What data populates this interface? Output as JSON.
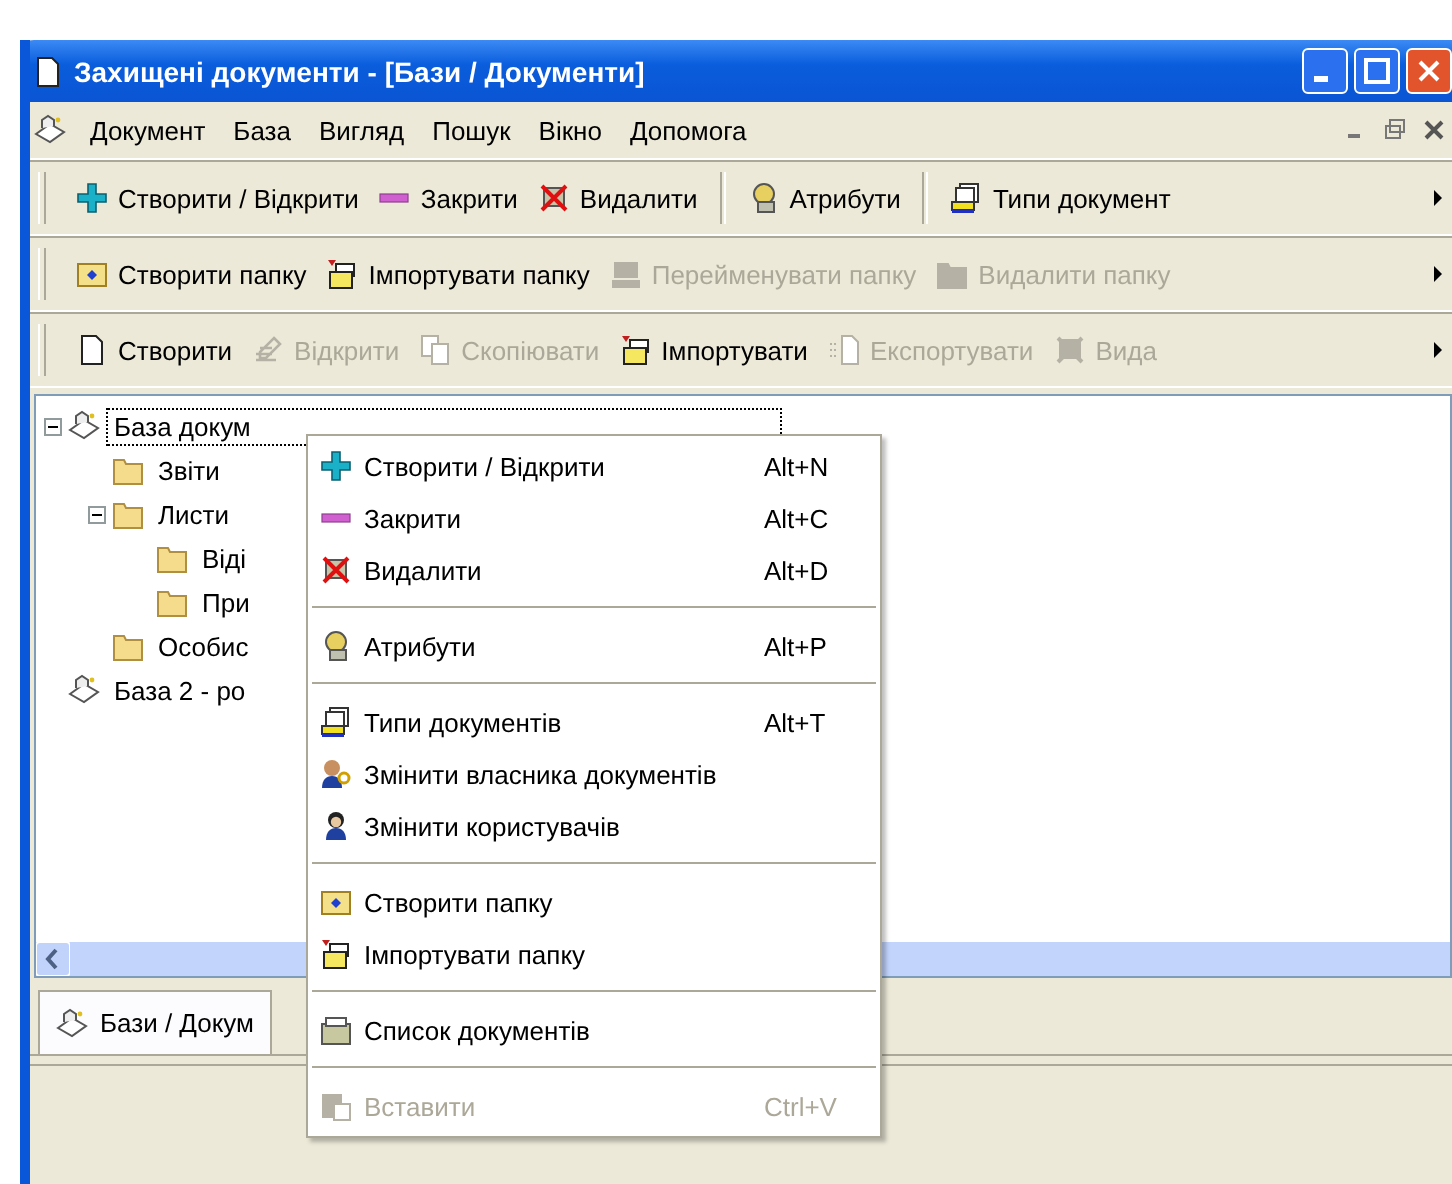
{
  "window": {
    "title": "Захищені документи - [Бази / Документи]"
  },
  "menu_bar": [
    "Документ",
    "База",
    "Вигляд",
    "Пошук",
    "Вікно",
    "Допомога"
  ],
  "toolbars": [
    [
      {
        "kind": "button",
        "label": "Створити / Відкрити",
        "disabled": false
      },
      {
        "kind": "button",
        "label": "Закрити",
        "disabled": false
      },
      {
        "kind": "button",
        "label": "Видалити",
        "disabled": false
      },
      {
        "kind": "separator"
      },
      {
        "kind": "button",
        "label": "Атрибути",
        "disabled": false
      },
      {
        "kind": "separator"
      },
      {
        "kind": "button",
        "label": "Типи документ",
        "disabled": false
      }
    ],
    [
      {
        "kind": "button",
        "label": "Створити папку",
        "disabled": false
      },
      {
        "kind": "button",
        "label": "Імпортувати папку",
        "disabled": false
      },
      {
        "kind": "button",
        "label": "Перейменувати папку",
        "disabled": true
      },
      {
        "kind": "button",
        "label": "Видалити папку",
        "disabled": true
      }
    ],
    [
      {
        "kind": "button",
        "label": "Створити",
        "disabled": false
      },
      {
        "kind": "button",
        "label": "Відкрити",
        "disabled": true
      },
      {
        "kind": "button",
        "label": "Скопіювати",
        "disabled": true
      },
      {
        "kind": "button",
        "label": "Імпортувати",
        "disabled": false
      },
      {
        "kind": "button",
        "label": "Експортувати",
        "disabled": true
      },
      {
        "kind": "button",
        "label": "Вида",
        "disabled": true
      }
    ]
  ],
  "tree": [
    {
      "label": "База докум",
      "kind": "database",
      "selected": true,
      "expanded": true,
      "children": [
        {
          "label": "Звіти",
          "kind": "folder",
          "selected": false
        },
        {
          "label": "Листи",
          "kind": "folder",
          "selected": false,
          "expanded": true,
          "children": [
            {
              "label": "Віді",
              "kind": "folder",
              "selected": false
            },
            {
              "label": "При",
              "kind": "folder",
              "selected": false
            }
          ]
        },
        {
          "label": "Особис",
          "kind": "folder",
          "selected": false
        }
      ]
    },
    {
      "label": "База 2 - ро",
      "kind": "database",
      "selected": false
    }
  ],
  "context_menu": [
    [
      {
        "label": "Створити / Відкрити",
        "shortcut": "Alt+N",
        "disabled": false
      },
      {
        "label": "Закрити",
        "shortcut": "Alt+C",
        "disabled": false
      },
      {
        "label": "Видалити",
        "shortcut": "Alt+D",
        "disabled": false
      }
    ],
    [
      {
        "label": "Атрибути",
        "shortcut": "Alt+P",
        "disabled": false
      }
    ],
    [
      {
        "label": "Типи документів",
        "shortcut": "Alt+T",
        "disabled": false
      },
      {
        "label": "Змінити власника документів",
        "disabled": false
      },
      {
        "label": "Змінити користувачів",
        "disabled": false
      }
    ],
    [
      {
        "label": "Створити папку",
        "disabled": false
      },
      {
        "label": "Імпортувати папку",
        "disabled": false
      }
    ],
    [
      {
        "label": "Список документів",
        "disabled": false
      }
    ],
    [
      {
        "label": "Вставити",
        "shortcut": "Ctrl+V",
        "disabled": true
      }
    ]
  ],
  "tabs": [
    {
      "label": "Бази / Докум",
      "selected": true
    }
  ]
}
